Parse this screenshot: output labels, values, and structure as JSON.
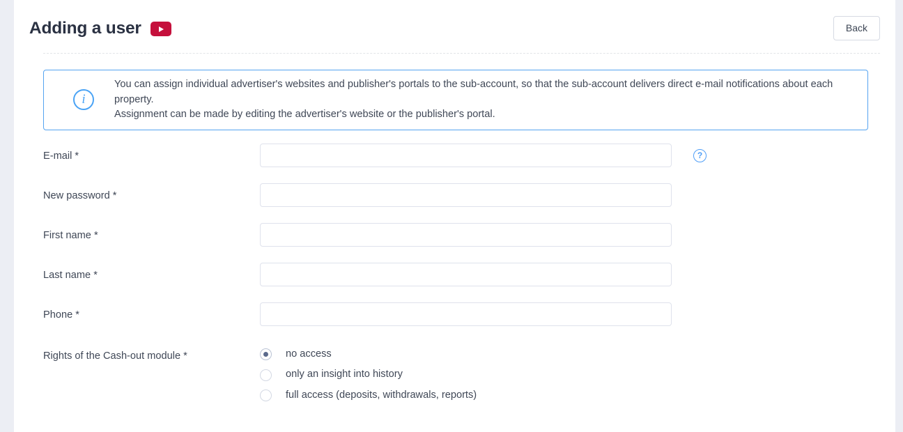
{
  "header": {
    "title": "Adding a user",
    "video_icon": "youtube-play-icon",
    "back_label": "Back"
  },
  "alert": {
    "icon": "info-circle-icon",
    "line1": "You can assign individual advertiser's websites and publisher's portals to the sub-account, so that the sub-account delivers direct e-mail notifications about each property.",
    "line2": "Assignment can be made by editing the advertiser's website or the publisher's portal.",
    "border_color": "#54a3f0",
    "icon_color": "#4aa3f5"
  },
  "form": {
    "fields": [
      {
        "label": "E-mail *",
        "value": "",
        "placeholder": "",
        "type": "email",
        "help_icon": "question-circle-icon"
      },
      {
        "label": "New password *",
        "value": "",
        "placeholder": "",
        "type": "password"
      },
      {
        "label": "First name *",
        "value": "",
        "placeholder": "",
        "type": "text"
      },
      {
        "label": "Last name *",
        "value": "",
        "placeholder": "",
        "type": "text"
      },
      {
        "label": "Phone *",
        "value": "",
        "placeholder": "",
        "type": "text"
      }
    ],
    "rights": {
      "label": "Rights of the Cash-out module *",
      "options": [
        {
          "label": "no access",
          "checked": true
        },
        {
          "label": "only an insight into history",
          "checked": false
        },
        {
          "label": "full access (deposits, withdrawals, reports)",
          "checked": false
        }
      ]
    }
  },
  "theme": {
    "page_background": "#eceef4",
    "card_background": "#ffffff",
    "title_color": "#2a3142",
    "text_color": "#3f4756",
    "youtube_red": "#c5103c",
    "input_border": "#dfe2ec",
    "radio_dot": "#5b6a8c"
  }
}
